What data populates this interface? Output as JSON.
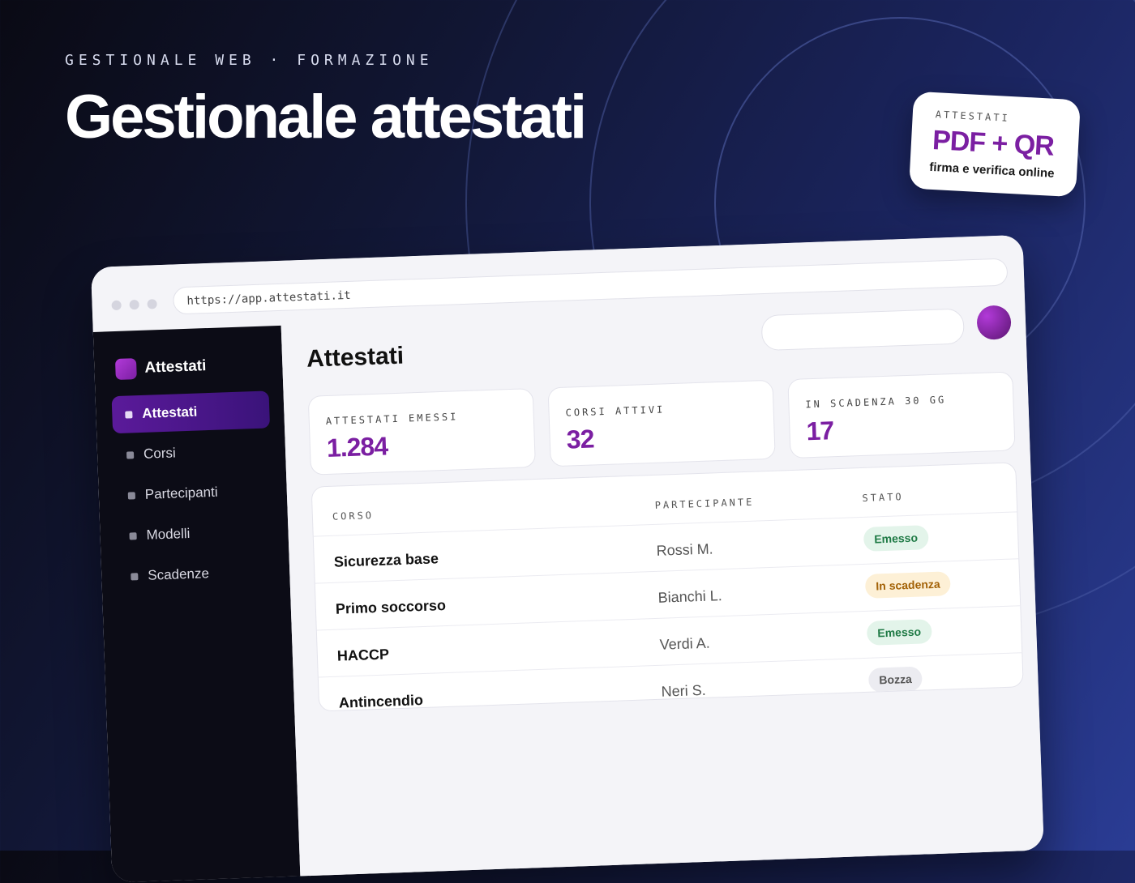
{
  "header": {
    "eyebrow": "GESTIONALE WEB · FORMAZIONE",
    "title": "Gestionale attestati"
  },
  "badge": {
    "eyebrow": "ATTESTATI",
    "main_left": "PDF",
    "main_plus": "+",
    "main_right": "QR",
    "subtitle": "firma e verifica online"
  },
  "browser": {
    "url": "https://app.attestati.it"
  },
  "sidebar": {
    "brand": "Attestati",
    "items": [
      {
        "label": "Attestati",
        "active": true
      },
      {
        "label": "Corsi",
        "active": false
      },
      {
        "label": "Partecipanti",
        "active": false
      },
      {
        "label": "Modelli",
        "active": false
      },
      {
        "label": "Scadenze",
        "active": false
      }
    ]
  },
  "main": {
    "title": "Attestati",
    "stats": [
      {
        "label": "ATTESTATI EMESSI",
        "value": "1.284"
      },
      {
        "label": "CORSI ATTIVI",
        "value": "32"
      },
      {
        "label": "IN SCADENZA 30 GG",
        "value": "17"
      }
    ],
    "table": {
      "columns": [
        "CORSO",
        "PARTECIPANTE",
        "STATO"
      ],
      "rows": [
        {
          "course": "Sicurezza base",
          "participant": "Rossi M.",
          "status": "Emesso"
        },
        {
          "course": "Primo soccorso",
          "participant": "Bianchi L.",
          "status": "In scadenza"
        },
        {
          "course": "HACCP",
          "participant": "Verdi A.",
          "status": "Emesso"
        },
        {
          "course": "Antincendio",
          "participant": "Neri S.",
          "status": "Bozza"
        }
      ]
    }
  },
  "colors": {
    "accent": "#7b1fa2",
    "sidebar_bg": "#0c0c16",
    "status_emesso": "#1f7a45",
    "status_scadenza": "#a36207",
    "status_bozza": "#555555"
  }
}
